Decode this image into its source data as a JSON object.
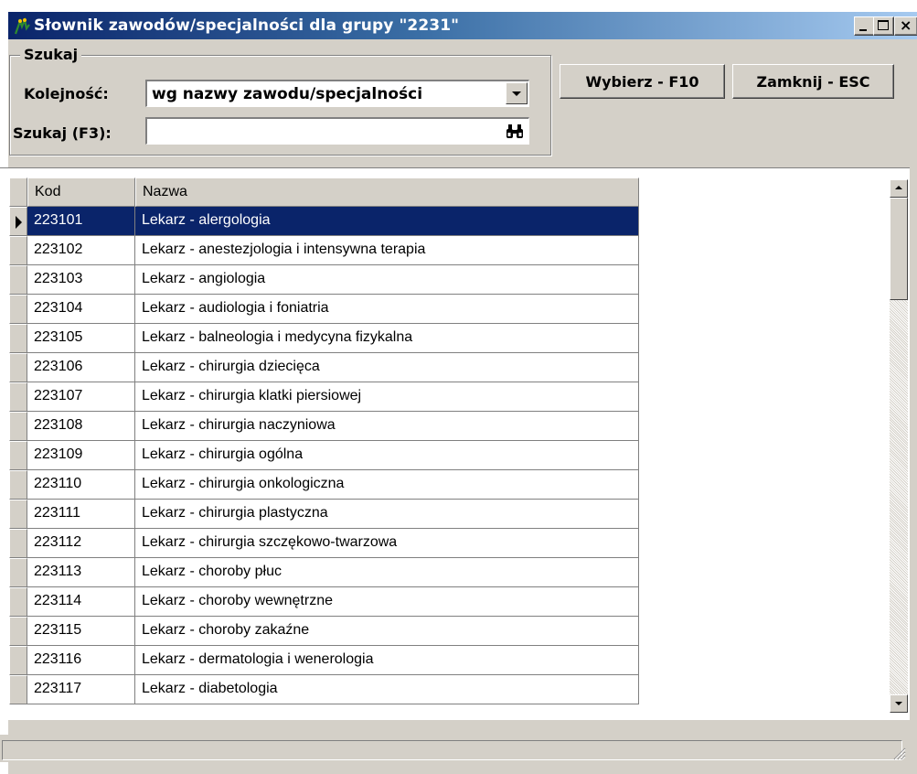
{
  "window": {
    "title": "Słownik zawodów/specjalności dla grupy \"2231\"",
    "icon": "app-icon"
  },
  "search_group": {
    "legend": "Szukaj",
    "order_label": "Kolejność:",
    "order_value": "wg nazwy zawodu/specjalności",
    "search_label": "Szukaj (F3):",
    "search_value": "",
    "search_icon": "binoculars-icon"
  },
  "buttons": {
    "select": "Wybierz - F10",
    "close": "Zamknij - ESC"
  },
  "table": {
    "columns": [
      "Kod",
      "Nazwa"
    ],
    "selected_index": 0,
    "rows": [
      {
        "kod": "223101",
        "nazwa": "Lekarz - alergologia"
      },
      {
        "kod": "223102",
        "nazwa": "Lekarz - anestezjologia i intensywna terapia"
      },
      {
        "kod": "223103",
        "nazwa": "Lekarz - angiologia"
      },
      {
        "kod": "223104",
        "nazwa": "Lekarz - audiologia i foniatria"
      },
      {
        "kod": "223105",
        "nazwa": "Lekarz - balneologia i medycyna fizykalna"
      },
      {
        "kod": "223106",
        "nazwa": "Lekarz - chirurgia dziecięca"
      },
      {
        "kod": "223107",
        "nazwa": "Lekarz - chirurgia klatki piersiowej"
      },
      {
        "kod": "223108",
        "nazwa": "Lekarz - chirurgia naczyniowa"
      },
      {
        "kod": "223109",
        "nazwa": "Lekarz - chirurgia ogólna"
      },
      {
        "kod": "223110",
        "nazwa": "Lekarz - chirurgia onkologiczna"
      },
      {
        "kod": "223111",
        "nazwa": "Lekarz - chirurgia plastyczna"
      },
      {
        "kod": "223112",
        "nazwa": "Lekarz - chirurgia szczękowo-twarzowa"
      },
      {
        "kod": "223113",
        "nazwa": "Lekarz - choroby płuc"
      },
      {
        "kod": "223114",
        "nazwa": "Lekarz - choroby wewnętrzne"
      },
      {
        "kod": "223115",
        "nazwa": "Lekarz - choroby zakaźne"
      },
      {
        "kod": "223116",
        "nazwa": "Lekarz - dermatologia i wenerologia"
      },
      {
        "kod": "223117",
        "nazwa": "Lekarz - diabetologia"
      }
    ]
  },
  "colors": {
    "selection": "#0a246a",
    "face": "#d4d0c8"
  }
}
